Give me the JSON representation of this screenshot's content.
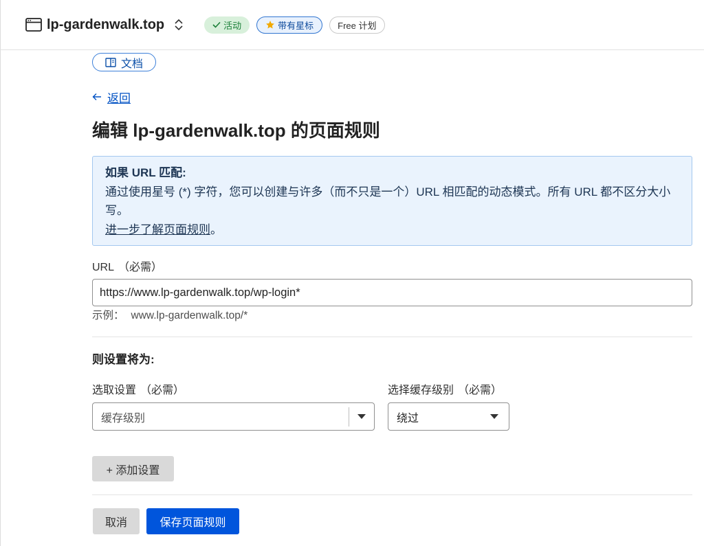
{
  "theme": {
    "accent": "#0051c3",
    "primary": "#0055dc",
    "ok": "#1a7f37",
    "ok_bg": "#d8f0db",
    "star": "#f2a900",
    "star_bg": "#e8f1fd",
    "star_border": "#2f74d0",
    "info_bg": "#eaf3fd",
    "info_border": "#a3c7ef",
    "info_text": "#1d3553",
    "btn_gray": "#d9d9d9"
  },
  "header": {
    "icon": "browser-window-icon",
    "site_name": "lp-gardenwalk.top",
    "switcher_icon": "chevron-up-down-icon",
    "badges": {
      "active": "活动",
      "active_icon": "check-icon",
      "starred": "带有星标",
      "starred_icon": "star-icon",
      "plan": "Free 计划"
    }
  },
  "docs_button": {
    "label": "文档",
    "icon": "book-icon"
  },
  "back_link": {
    "label": "返回",
    "icon": "arrow-left-icon"
  },
  "page_title": "编辑 lp-gardenwalk.top 的页面规则",
  "info_box": {
    "heading": "如果 URL 匹配:",
    "body": "通过使用星号 (*) 字符，您可以创建与许多（而不只是一个）URL 相匹配的动态模式。所有 URL 都不区分大小写。",
    "link": "进一步了解页面规则",
    "link_suffix": "。"
  },
  "url_field": {
    "label": "URL",
    "required": "（必需）",
    "value": "https://www.lp-gardenwalk.top/wp-login*",
    "example_label": "示例：",
    "example_value": "www.lp-gardenwalk.top/*"
  },
  "settings": {
    "heading": "则设置将为:",
    "setting_select": {
      "label": "选取设置",
      "required": "（必需）",
      "value": "缓存级别",
      "icon": "caret-down-icon"
    },
    "cache_select": {
      "label": "选择缓存级别",
      "required": "（必需）",
      "value": "绕过",
      "icon": "caret-down-icon"
    }
  },
  "add_setting_button": "+ 添加设置",
  "footer": {
    "cancel": "取消",
    "save": "保存页面规则"
  }
}
